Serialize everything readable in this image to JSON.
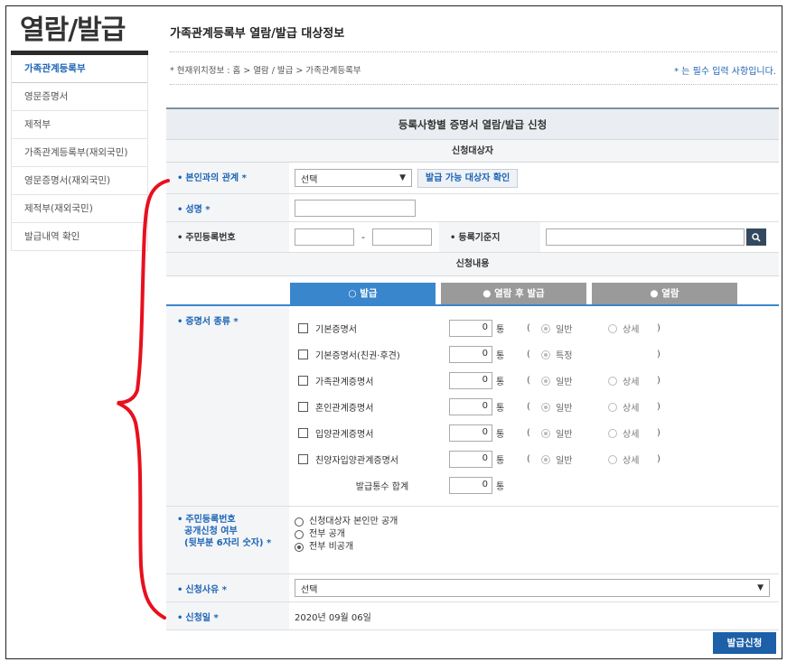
{
  "brand": "열람/발급",
  "sidebar": [
    {
      "label": "가족관계등록부",
      "active": true
    },
    {
      "label": "영문증명서"
    },
    {
      "label": "제적부"
    },
    {
      "label": "가족관계등록부(재외국민)"
    },
    {
      "label": "영문증명서(재외국민)"
    },
    {
      "label": "제적부(재외국민)"
    },
    {
      "label": "발급내역 확인"
    }
  ],
  "header": {
    "title": "가족관계등록부 열람/발급 대상정보",
    "location": "* 현재위치정보 : 홈 > 열람 / 발급 > 가족관계등록부",
    "required_note": "* 는 필수 입력 사항입니다."
  },
  "form": {
    "title": "등록사항별 증명서 열람/발급 신청",
    "section_target": "신청대상자",
    "relation_label": "본인과의 관계 *",
    "relation_value": "선택",
    "check_button": "발급 가능 대상자 확인",
    "name_label": "성명 *",
    "rrn_label": "주민등록번호",
    "rrn_dash": "-",
    "base_label": "등록기준지",
    "section_content": "신청내용",
    "tabs": [
      "발급",
      "열람 후 발급",
      "열람"
    ],
    "cert_label": "증명서 종류 *",
    "certs": [
      {
        "name": "기본증명서",
        "qty": "0",
        "unit": "통",
        "a": "일반",
        "b": "상세"
      },
      {
        "name": "기본증명서(친권·후견)",
        "qty": "0",
        "unit": "통",
        "a": "특정",
        "b": ""
      },
      {
        "name": "가족관계증명서",
        "qty": "0",
        "unit": "통",
        "a": "일반",
        "b": "상세"
      },
      {
        "name": "혼인관계증명서",
        "qty": "0",
        "unit": "통",
        "a": "일반",
        "b": "상세"
      },
      {
        "name": "입양관계증명서",
        "qty": "0",
        "unit": "통",
        "a": "일반",
        "b": "상세"
      },
      {
        "name": "친양자입양관계증명서",
        "qty": "0",
        "unit": "통",
        "a": "일반",
        "b": "상세"
      }
    ],
    "paren_open": "(",
    "paren_close": ")",
    "total_label": "발급통수 합계",
    "total_qty": "0",
    "total_unit": "통",
    "disclose_label": [
      "주민등록번호",
      "공개신청 여부",
      "(뒷부분 6자리 숫자) *"
    ],
    "disclose_options": [
      "신청대상자 본인만 공개",
      "전부 공개",
      "전부 비공개"
    ],
    "disclose_selected": 2,
    "reason_label": "신청사유 *",
    "reason_value": "선택",
    "date_label": "신청일 *",
    "date_value": "2020년 09월 06일",
    "submit": "발급신청"
  },
  "colors": {
    "accent": "#1d64b5",
    "tab_on": "#3a86cd",
    "tab_off": "#9a9a9a",
    "annotation": "#e8101e"
  }
}
